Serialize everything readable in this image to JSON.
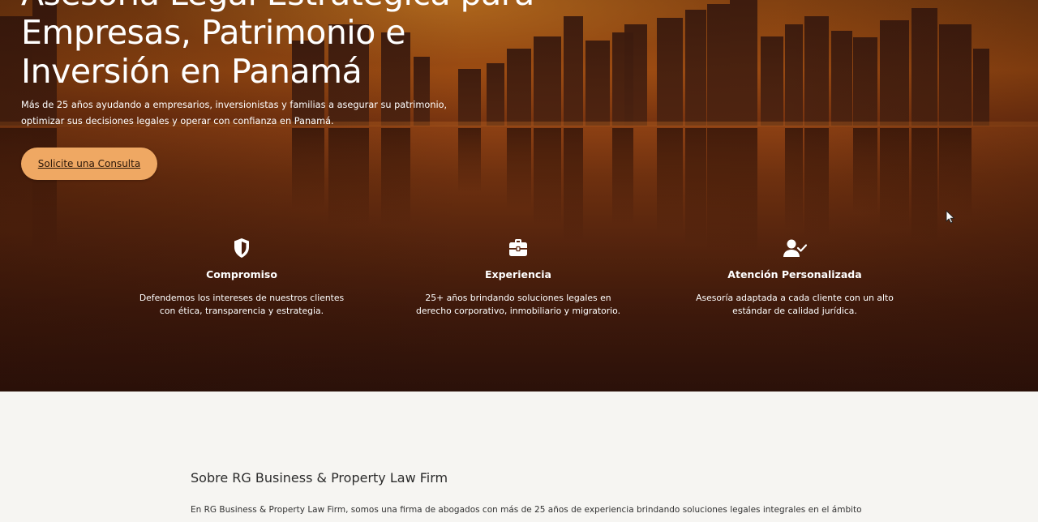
{
  "hero": {
    "title_lines": [
      "Asesoría Legal Estratégica para",
      "Empresas, Patrimonio e",
      "Inversión en Panamá"
    ],
    "subtitle": "Más de 25 años ayudando a empresarios, inversionistas y familias a asegurar su patrimonio, optimizar sus decisiones legales y operar con confianza en Panamá.",
    "cta_label": "Solicite una Consulta",
    "cta_color": "#efa863",
    "background_colors": [
      "#9a4a12",
      "#5a240c",
      "#2e120a"
    ]
  },
  "features": [
    {
      "icon": "shield-icon",
      "title": "Compromiso",
      "description": "Defendemos los intereses de nuestros clientes con ética, transparencia y estrategia."
    },
    {
      "icon": "briefcase-icon",
      "title": "Experiencia",
      "description": "25+ años brindando soluciones legales en derecho corporativo, inmobiliario y migratorio."
    },
    {
      "icon": "user-check-icon",
      "title": "Atención Personalizada",
      "description": "Asesoría adaptada a cada cliente con un alto estándar de calidad jurídica."
    }
  ],
  "about": {
    "title": "Sobre RG Business & Property Law Firm",
    "text": "En RG Business & Property Law Firm, somos una firma de abogados con más de 25 años de experiencia brindando soluciones legales integrales en el ámbito"
  }
}
